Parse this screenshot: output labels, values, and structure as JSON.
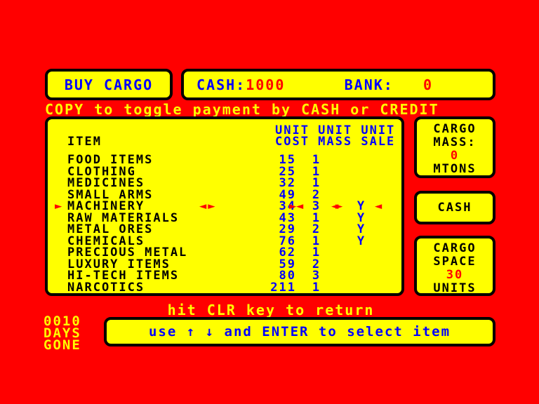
{
  "colors": {
    "background": "#ff0000",
    "panel_fill": "#ffff00",
    "panel_border": "#000000",
    "accent_blue": "#0000ff",
    "accent_red": "#ff0000",
    "accent_yellow": "#ffff00"
  },
  "header": {
    "buy_cargo_label": "BUY CARGO",
    "cash_label": "CASH:",
    "cash_value": "1000",
    "bank_label": "BANK:",
    "bank_value": "0",
    "copy_hint": "COPY to toggle payment by CASH or CREDIT"
  },
  "table": {
    "item_header": "ITEM",
    "unit_row": "UNIT UNIT UNIT",
    "sub_row": "COST MASS SALE",
    "columns": [
      "ITEM",
      "UNIT COST",
      "UNIT MASS",
      "UNIT SALE"
    ],
    "cursor_glyph": "►",
    "sel_left_glyph": "◄►",
    "sel_right_glyph": "◄",
    "sel_point_glyph": "►",
    "selected_index": 4,
    "rows": [
      {
        "name": "FOOD ITEMS",
        "cost": "15",
        "mass": "1",
        "sale": ""
      },
      {
        "name": "CLOTHING",
        "cost": "25",
        "mass": "1",
        "sale": ""
      },
      {
        "name": "MEDICINES",
        "cost": "32",
        "mass": "1",
        "sale": ""
      },
      {
        "name": "SMALL ARMS",
        "cost": "49",
        "mass": "2",
        "sale": ""
      },
      {
        "name": "MACHINERY",
        "cost": "34",
        "mass": "3",
        "sale": "Y"
      },
      {
        "name": "RAW MATERIALS",
        "cost": "43",
        "mass": "1",
        "sale": "Y"
      },
      {
        "name": "METAL ORES",
        "cost": "29",
        "mass": "2",
        "sale": "Y"
      },
      {
        "name": "CHEMICALS",
        "cost": "76",
        "mass": "1",
        "sale": "Y"
      },
      {
        "name": "PRECIOUS METAL",
        "cost": "62",
        "mass": "1",
        "sale": ""
      },
      {
        "name": "LUXURY ITEMS",
        "cost": "59",
        "mass": "2",
        "sale": ""
      },
      {
        "name": "HI-TECH ITEMS",
        "cost": "80",
        "mass": "3",
        "sale": ""
      },
      {
        "name": "NARCOTICS",
        "cost": "211",
        "mass": "1",
        "sale": ""
      }
    ]
  },
  "sidebar": {
    "cargo_mass": {
      "line1": "CARGO",
      "line2": "MASS:",
      "value": "0",
      "line4": "MTONS"
    },
    "cash_button": "CASH",
    "cargo_space": {
      "line1": "CARGO",
      "line2": "SPACE",
      "value": "30",
      "line4": "UNITS"
    }
  },
  "footer": {
    "clr_hint": "hit CLR key to return",
    "days_count": "0010",
    "days_line2": "DAYS",
    "days_line3": "GONE",
    "instruction_pre": "use ",
    "arrow_up": "↑",
    "arrow_down": "↓",
    "instruction_post": " and ENTER to select item"
  }
}
